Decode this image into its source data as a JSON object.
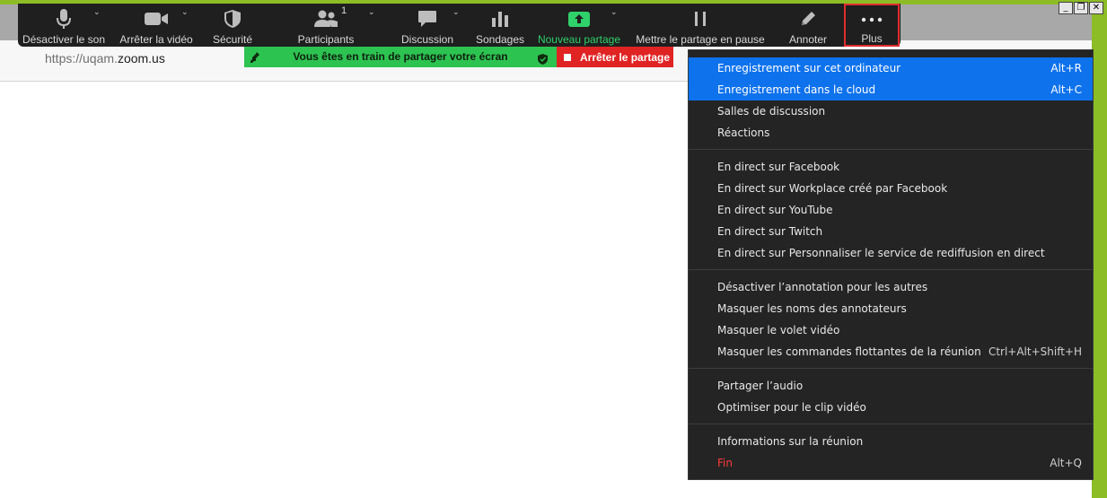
{
  "browser": {
    "url_prefix": "https://uqam.",
    "url_domain": "zoom.us",
    "win_minimize": "_",
    "win_restore": "❐",
    "win_close": "✕"
  },
  "toolbar": {
    "items": [
      {
        "label": "Désactiver le son",
        "icon": "microphone-icon"
      },
      {
        "label": "Arrêter la vidéo",
        "icon": "video-camera-icon"
      },
      {
        "label": "Sécurité",
        "icon": "shield-icon"
      },
      {
        "label": "Participants",
        "icon": "participants-icon",
        "count": "1"
      },
      {
        "label": "Discussion",
        "icon": "chat-bubble-icon"
      },
      {
        "label": "Sondages",
        "icon": "poll-bars-icon"
      },
      {
        "label": "Nouveau partage",
        "icon": "share-screen-icon"
      },
      {
        "label": "Mettre le partage en pause",
        "icon": "pause-icon"
      },
      {
        "label": "Annoter",
        "icon": "pencil-icon"
      },
      {
        "label": "Plus",
        "icon": "more-dots-icon"
      }
    ]
  },
  "share_banner": {
    "text": "Vous êtes en train de partager votre écran",
    "stop_label": "Arrêter le partage"
  },
  "menu": {
    "items": [
      {
        "label": "Enregistrement sur cet ordinateur",
        "shortcut": "Alt+R"
      },
      {
        "label": "Enregistrement dans le cloud",
        "shortcut": "Alt+C"
      },
      {
        "label": "Salles de discussion",
        "shortcut": ""
      },
      {
        "label": "Réactions",
        "shortcut": ""
      },
      {
        "label": "En direct sur Facebook",
        "shortcut": ""
      },
      {
        "label": "En direct sur Workplace créé par Facebook",
        "shortcut": ""
      },
      {
        "label": "En direct sur YouTube",
        "shortcut": ""
      },
      {
        "label": "En direct sur Twitch",
        "shortcut": ""
      },
      {
        "label": "En direct sur Personnaliser le service de rediffusion en direct",
        "shortcut": ""
      },
      {
        "label": "Désactiver l’annotation pour les autres",
        "shortcut": ""
      },
      {
        "label": "Masquer les noms des annotateurs",
        "shortcut": ""
      },
      {
        "label": "Masquer le volet vidéo",
        "shortcut": ""
      },
      {
        "label": "Masquer les commandes flottantes de la réunion",
        "shortcut": "Ctrl+Alt+Shift+H"
      },
      {
        "label": "Partager l’audio",
        "shortcut": ""
      },
      {
        "label": "Optimiser pour le clip vidéo",
        "shortcut": ""
      },
      {
        "label": "Informations sur la réunion",
        "shortcut": ""
      },
      {
        "label": "Fin",
        "shortcut": "Alt+Q"
      }
    ]
  },
  "colors": {
    "toolbar_bg": "#1f1f1f",
    "menu_bg": "#242424",
    "menu_highlight": "#0e72ed",
    "share_green": "#2dc351",
    "stop_red": "#e02424",
    "end_red": "#ff3b3b",
    "accent_green": "#8cbc26"
  }
}
